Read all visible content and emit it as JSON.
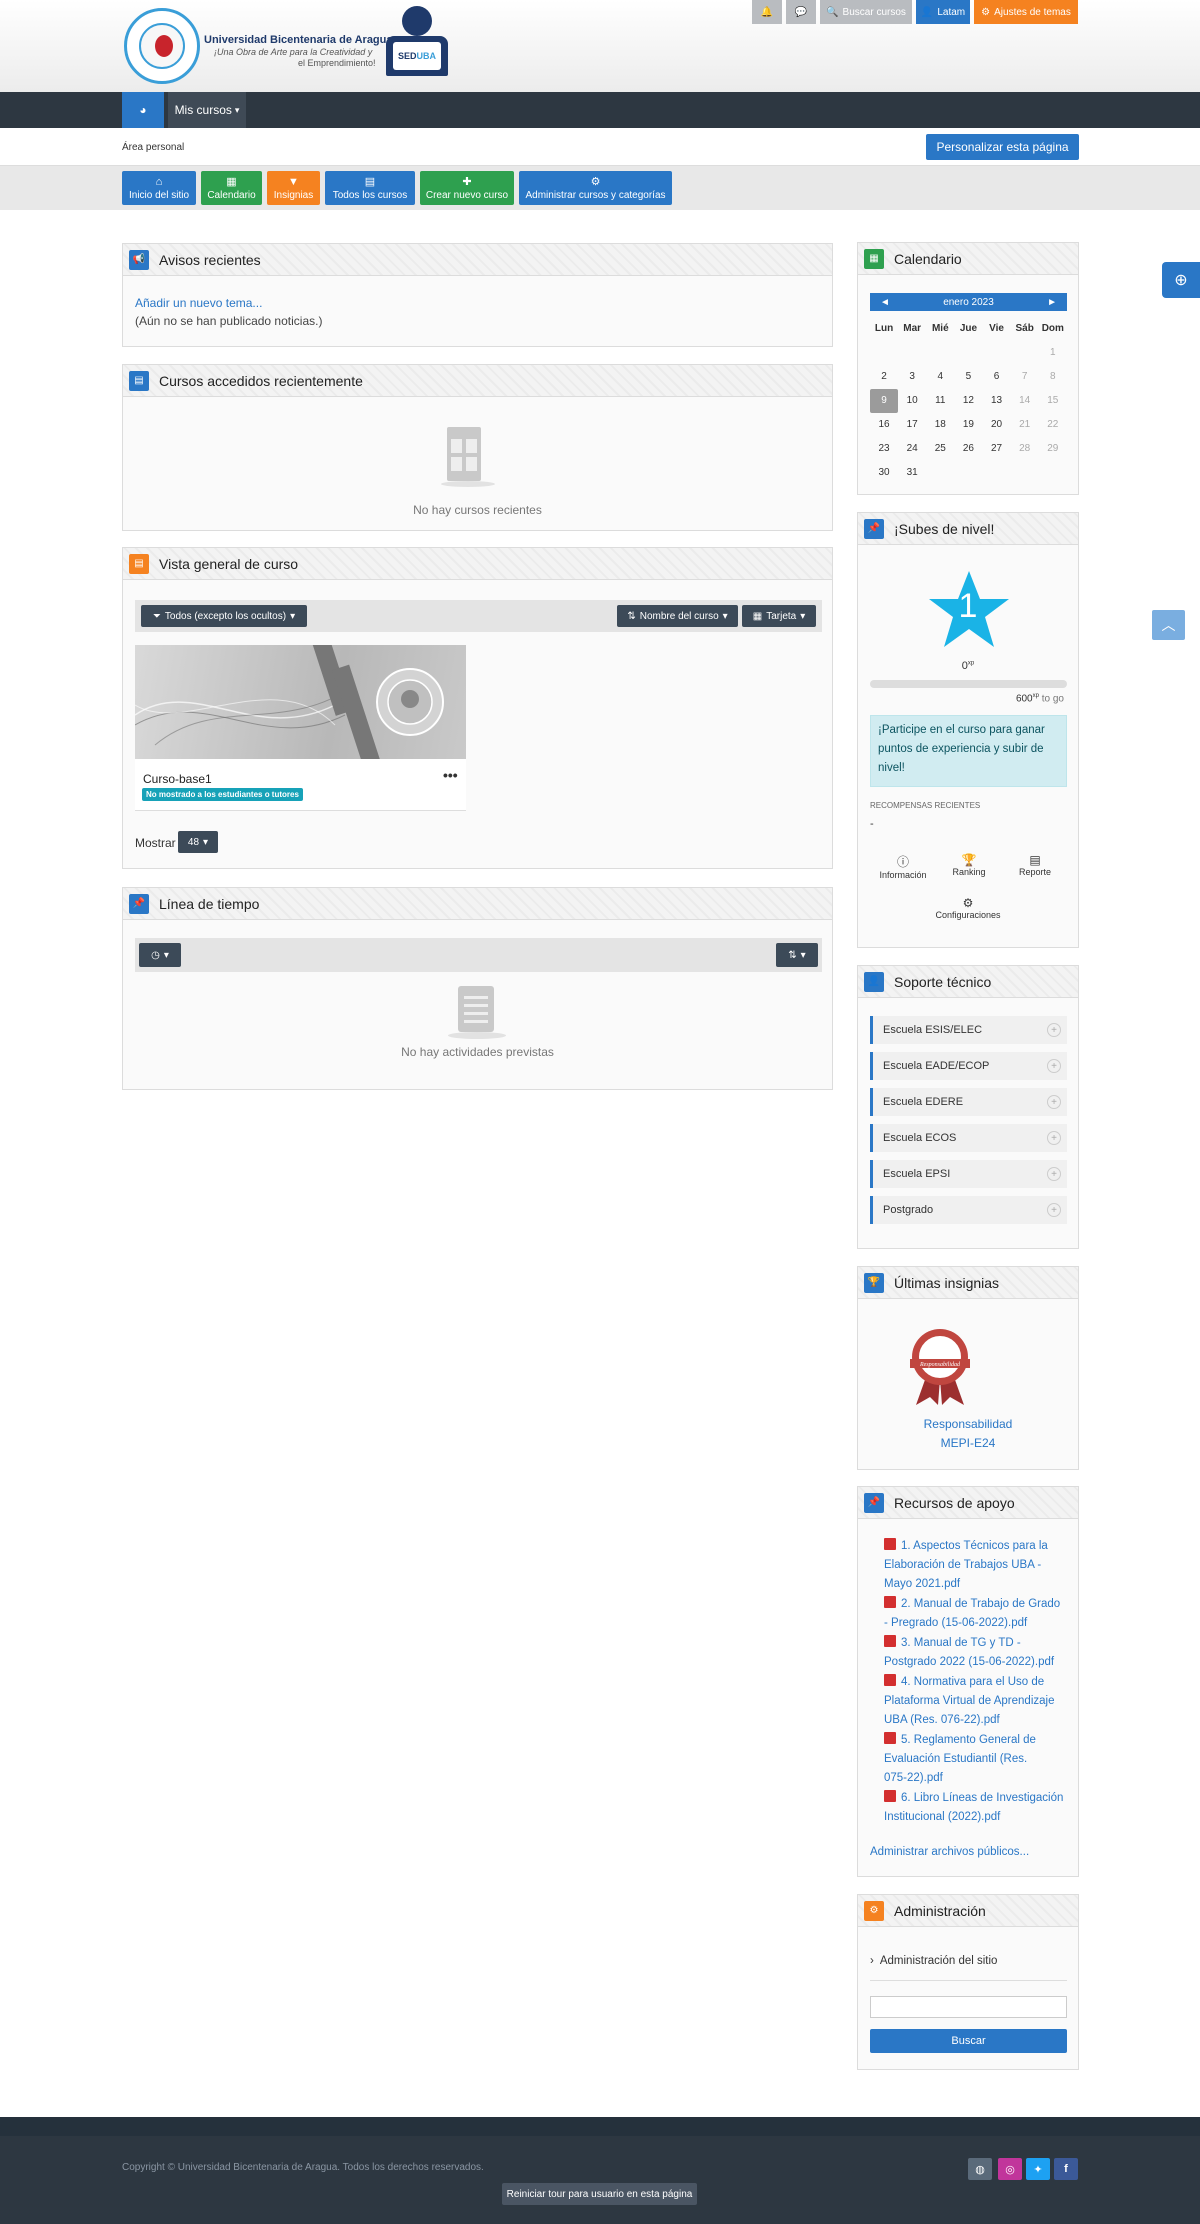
{
  "header": {
    "university_name": "Universidad Bicentenaria de Aragua",
    "slogan_line1": "¡Una Obra de Arte para la Creatividad y",
    "slogan_line2": "el Emprendimiento!",
    "seduba_text_a": "SED",
    "seduba_text_b": "UBA",
    "search_label": "Buscar cursos",
    "language_label": "Latam",
    "theme_settings_label": "Ajustes de temas"
  },
  "navbar": {
    "my_courses_label": "Mis cursos"
  },
  "breadcrumb": "Área personal",
  "customize_button": "Personalizar esta página",
  "quick_links": [
    {
      "label": "Inicio del sitio",
      "icon": "home-icon",
      "color": "#2a77c6"
    },
    {
      "label": "Calendario",
      "icon": "calendar-icon",
      "color": "#2ea04f"
    },
    {
      "label": "Insignias",
      "icon": "bookmark-icon",
      "color": "#f58220"
    },
    {
      "label": "Todos los cursos",
      "icon": "book-icon",
      "color": "#2a77c6"
    },
    {
      "label": "Crear nuevo curso",
      "icon": "plus-icon",
      "color": "#2ea04f"
    },
    {
      "label": "Administrar cursos y categorías",
      "icon": "cogs-icon",
      "color": "#2a77c6"
    }
  ],
  "news": {
    "title": "Avisos recientes",
    "add_link": "Añadir un nuevo tema...",
    "empty": "(Aún no se han publicado noticias.)"
  },
  "recent_courses": {
    "title": "Cursos accedidos recientemente",
    "empty": "No hay cursos recientes"
  },
  "course_overview": {
    "title": "Vista general de curso",
    "filter_label": "Todos (excepto los ocultos)",
    "sort_label": "Nombre del curso",
    "view_label": "Tarjeta",
    "course_name": "Curso-base1",
    "hidden_badge": "No mostrado a los estudiantes o tutores",
    "show_label": "Mostrar",
    "show_count": "48"
  },
  "timeline": {
    "title": "Línea de tiempo",
    "empty": "No hay actividades previstas"
  },
  "calendar": {
    "title": "Calendario",
    "month": "enero 2023",
    "prev": "◄",
    "next": "►",
    "weekdays": [
      "Lun",
      "Mar",
      "Mié",
      "Jue",
      "Vie",
      "Sáb",
      "Dom"
    ],
    "weeks": [
      [
        "",
        "",
        "",
        "",
        "",
        "",
        "1"
      ],
      [
        "2",
        "3",
        "4",
        "5",
        "6",
        "7",
        "8"
      ],
      [
        "9",
        "10",
        "11",
        "12",
        "13",
        "14",
        "15"
      ],
      [
        "16",
        "17",
        "18",
        "19",
        "20",
        "21",
        "22"
      ],
      [
        "23",
        "24",
        "25",
        "26",
        "27",
        "28",
        "29"
      ],
      [
        "30",
        "31",
        "",
        "",
        "",
        "",
        ""
      ]
    ],
    "today": "9"
  },
  "level_up": {
    "title": "¡Subes de nivel!",
    "level": "1",
    "points": "0",
    "points_unit": "xp",
    "goal": "600",
    "goal_unit": "xp",
    "goal_suffix": "to go",
    "progress": 0,
    "info": "¡Participe en el curso para ganar puntos de experiencia y subir de nivel!",
    "recent_rewards_label": "RECOMPENSAS RECIENTES",
    "recent_rewards_value": "-",
    "links": [
      "Información",
      "Ranking",
      "Reporte",
      "Configuraciones"
    ]
  },
  "support": {
    "title": "Soporte técnico",
    "items": [
      "Escuela ESIS/ELEC",
      "Escuela EADE/ECOP",
      "Escuela EDERE",
      "Escuela ECOS",
      "Escuela EPSI",
      "Postgrado"
    ]
  },
  "badges": {
    "title": "Últimas insignias",
    "badge_text": "Responsabilidad",
    "badge_name_line1": "Responsabilidad",
    "badge_name_line2": "MEPI-E24"
  },
  "resources": {
    "title": "Recursos de apoyo",
    "items": [
      {
        "l1": "1. Aspectos Técnicos para la",
        "l2": "Elaboración de Trabajos UBA -",
        "l3": "Mayo 2021.pdf"
      },
      {
        "l1": "2. Manual de Trabajo de Grado",
        "l2": "- Pregrado (15-06-2022).pdf",
        "l3": ""
      },
      {
        "l1": "3. Manual de TG y TD -",
        "l2": "Postgrado 2022 (15-06-2022).pdf",
        "l3": ""
      },
      {
        "l1": "4. Normativa para el Uso de",
        "l2": "Plataforma Virtual de Aprendizaje",
        "l3": "UBA (Res. 076-22).pdf"
      },
      {
        "l1": "5. Reglamento General de",
        "l2": "Evaluación Estudiantil (Res.",
        "l3": "075-22).pdf"
      },
      {
        "l1": "6. Libro Líneas de Investigación",
        "l2": "Institucional (2022).pdf",
        "l3": ""
      }
    ],
    "manage_link": "Administrar archivos públicos..."
  },
  "admin": {
    "title": "Administración",
    "site_admin": "Administración del sitio",
    "search_button": "Buscar"
  },
  "footer": {
    "copyright": "Copyright © Universidad Bicentenaria de Aragua. Todos los derechos reservados.",
    "tour_button": "Reiniciar tour para usuario en esta página"
  },
  "colors": {
    "primary": "#2a77c6",
    "orange": "#f58220",
    "green": "#2ea04f",
    "navbar": "#2d3741",
    "star": "#1ab3e6"
  }
}
